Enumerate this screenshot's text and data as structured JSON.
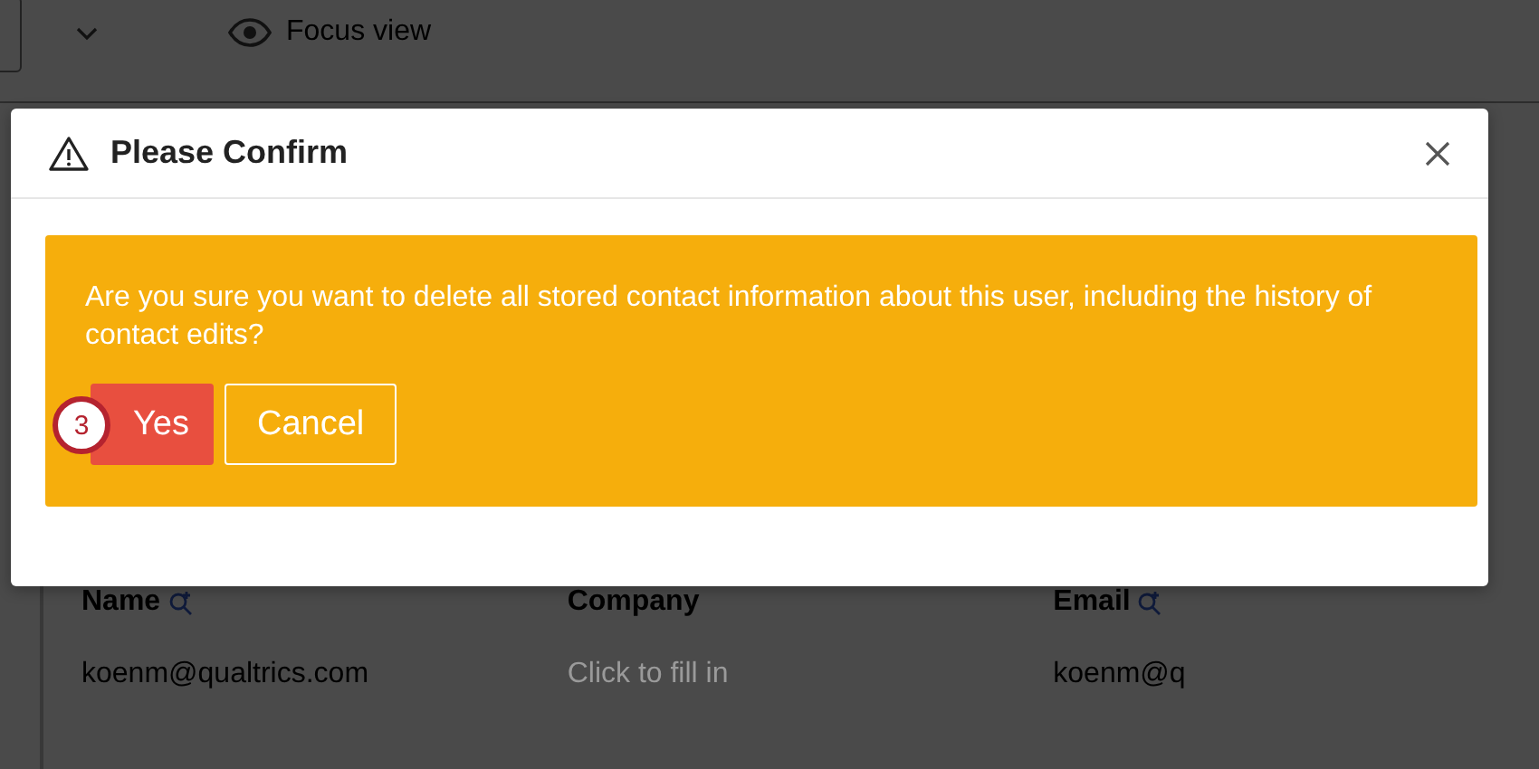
{
  "toolbar": {
    "focus_view": "Focus view"
  },
  "dialog": {
    "title": "Please Confirm",
    "message": "Are you sure you want to delete all stored contact information about this user, including the history of contact edits?",
    "buttons": [
      {
        "label": "Yes",
        "kind": "danger"
      },
      {
        "label": "Cancel",
        "kind": "outline"
      }
    ],
    "step_badge": "3"
  },
  "table": {
    "columns": [
      {
        "label": "Name",
        "searchable": true
      },
      {
        "label": "Company",
        "searchable": false
      },
      {
        "label": "Email",
        "searchable": true
      }
    ],
    "rows": [
      [
        {
          "text": "koenm@qualtrics.com",
          "placeholder": false
        },
        {
          "text": "Click to fill in",
          "placeholder": true
        },
        {
          "text": "koenm@q",
          "placeholder": false
        }
      ]
    ]
  }
}
